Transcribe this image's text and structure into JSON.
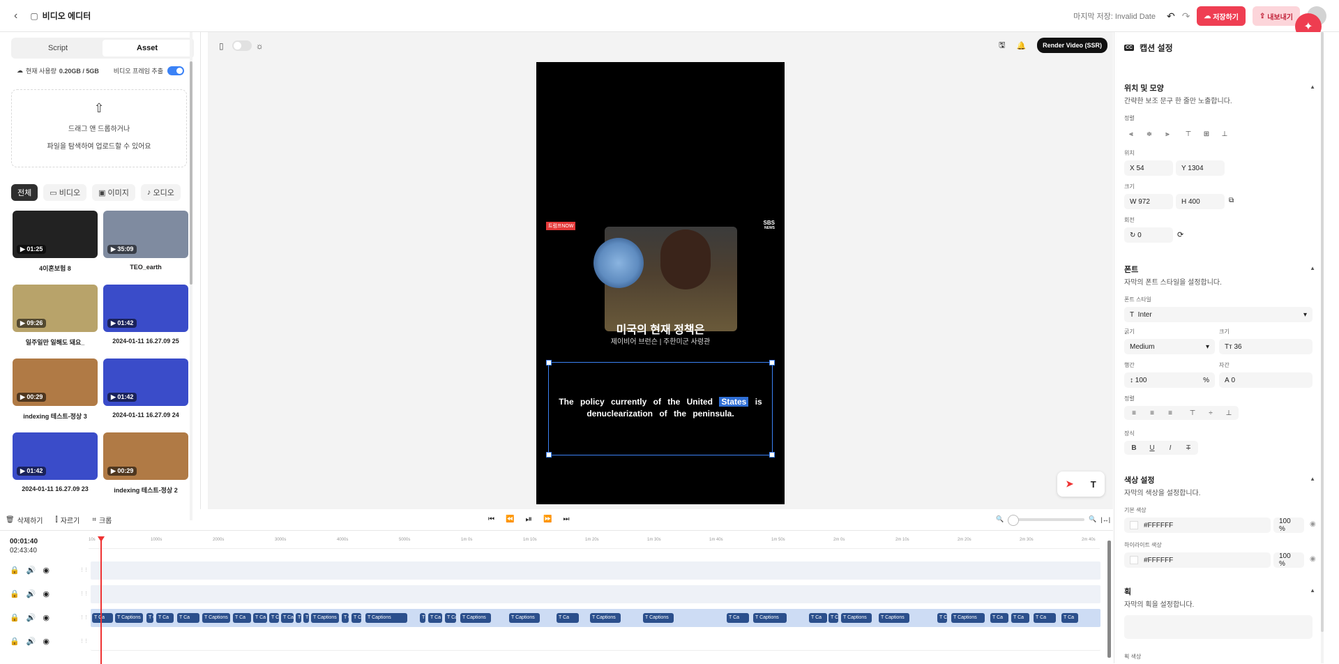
{
  "header": {
    "title": "비디오 에디터",
    "last_saved": "마지막 저장: Invalid Date",
    "save_label": "저장하기",
    "export_label": "내보내기"
  },
  "left": {
    "tabs": [
      "Script",
      "Asset"
    ],
    "active_tab": "Asset",
    "usage_label": "현재 사용량",
    "usage_value": "0.20GB / 5GB",
    "frame_extract_label": "비디오 프레임 추출",
    "drop_line1": "드래그 앤 드롭하거나",
    "drop_line2": "파일을 탐색하여 업로드할 수 있어요",
    "filters": [
      "전체",
      "비디오",
      "이미지",
      "오디오"
    ],
    "assets": [
      {
        "duration": "01:25",
        "name": "4이혼보험 8",
        "tone": "#222222"
      },
      {
        "duration": "35:09",
        "name": "TEO_earth",
        "tone": "#7f8ba0"
      },
      {
        "duration": "09:26",
        "name": "일주일만 일해도 돼요_",
        "tone": "#b8a36a"
      },
      {
        "duration": "01:42",
        "name": "2024-01-11 16.27.09 25",
        "tone": "#3a4cc9"
      },
      {
        "duration": "00:29",
        "name": "indexing 테스트-정상 3",
        "tone": "#b07a45"
      },
      {
        "duration": "01:42",
        "name": "2024-01-11 16.27.09 24",
        "tone": "#3a4cc9"
      },
      {
        "duration": "01:42",
        "name": "2024-01-11 16.27.09 23",
        "tone": "#3a4cc9"
      },
      {
        "duration": "00:29",
        "name": "indexing 테스트-정상 2",
        "tone": "#b07a45"
      }
    ]
  },
  "canvas": {
    "render_label": "Render Video (SSR)",
    "tag_text": "트럼프NOW",
    "logo_text": "SBS",
    "logo_sub": "NEWS",
    "headline": "미국의 현재 정책은",
    "subline": "제이비어 브런슨 | 주한미군 사령관",
    "caption_before": "The policy currently of the United",
    "caption_highlight": "States",
    "caption_after": "is denuclearization of the peninsula."
  },
  "props": {
    "title": "캡션 설정",
    "pos_section": "위치 및 모양",
    "pos_desc": "간략한 보조 문구 한 줄만 노출합니다.",
    "align_label": "정렬",
    "position_label": "위치",
    "x_value": "X 54",
    "y_value": "Y 1304",
    "size_label": "크기",
    "w_value": "W 972",
    "h_value": "H 400",
    "rotate_label": "회전",
    "rotate_value": "0",
    "font_section": "폰트",
    "font_desc": "자막의 폰트 스타일을 설정합니다.",
    "font_style_label": "폰트 스타일",
    "font_name": "Inter",
    "weight_label": "굵기",
    "weight_value": "Medium",
    "size2_label": "크기",
    "font_size": "36",
    "line_label": "행간",
    "line_value": "100",
    "line_unit": "%",
    "letter_label": "자간",
    "letter_value": "0",
    "align2_label": "정렬",
    "deco_label": "장식",
    "color_section": "색상 설정",
    "color_desc": "자막의 색상을 설정합니다.",
    "base_color_label": "기본 색상",
    "base_color": "#FFFFFF",
    "base_opacity": "100 %",
    "hl_color_label": "하이라이트 색상",
    "hl_color": "#FFFFFF",
    "hl_opacity": "100 %",
    "stroke_section": "획",
    "stroke_desc": "자막의 획을 설정합니다.",
    "stroke_color_label": "획 색상"
  },
  "timeline": {
    "delete_label": "삭제하기",
    "cut_label": "자르기",
    "crop_label": "크롭",
    "current_time": "00:01:40",
    "total_time": "02:43:40",
    "ruler": [
      "10s",
      "1000s",
      "2000s",
      "3000s",
      "4000s",
      "5000s",
      "1m 0s",
      "1m 10s",
      "1m 20s",
      "1m 30s",
      "1m 40s",
      "1m 50s",
      "2m 0s",
      "2m 10s",
      "2m 20s",
      "2m 30s",
      "2m 40s"
    ],
    "clip_label_full": "Captions",
    "clip_label_short": "Ca"
  }
}
